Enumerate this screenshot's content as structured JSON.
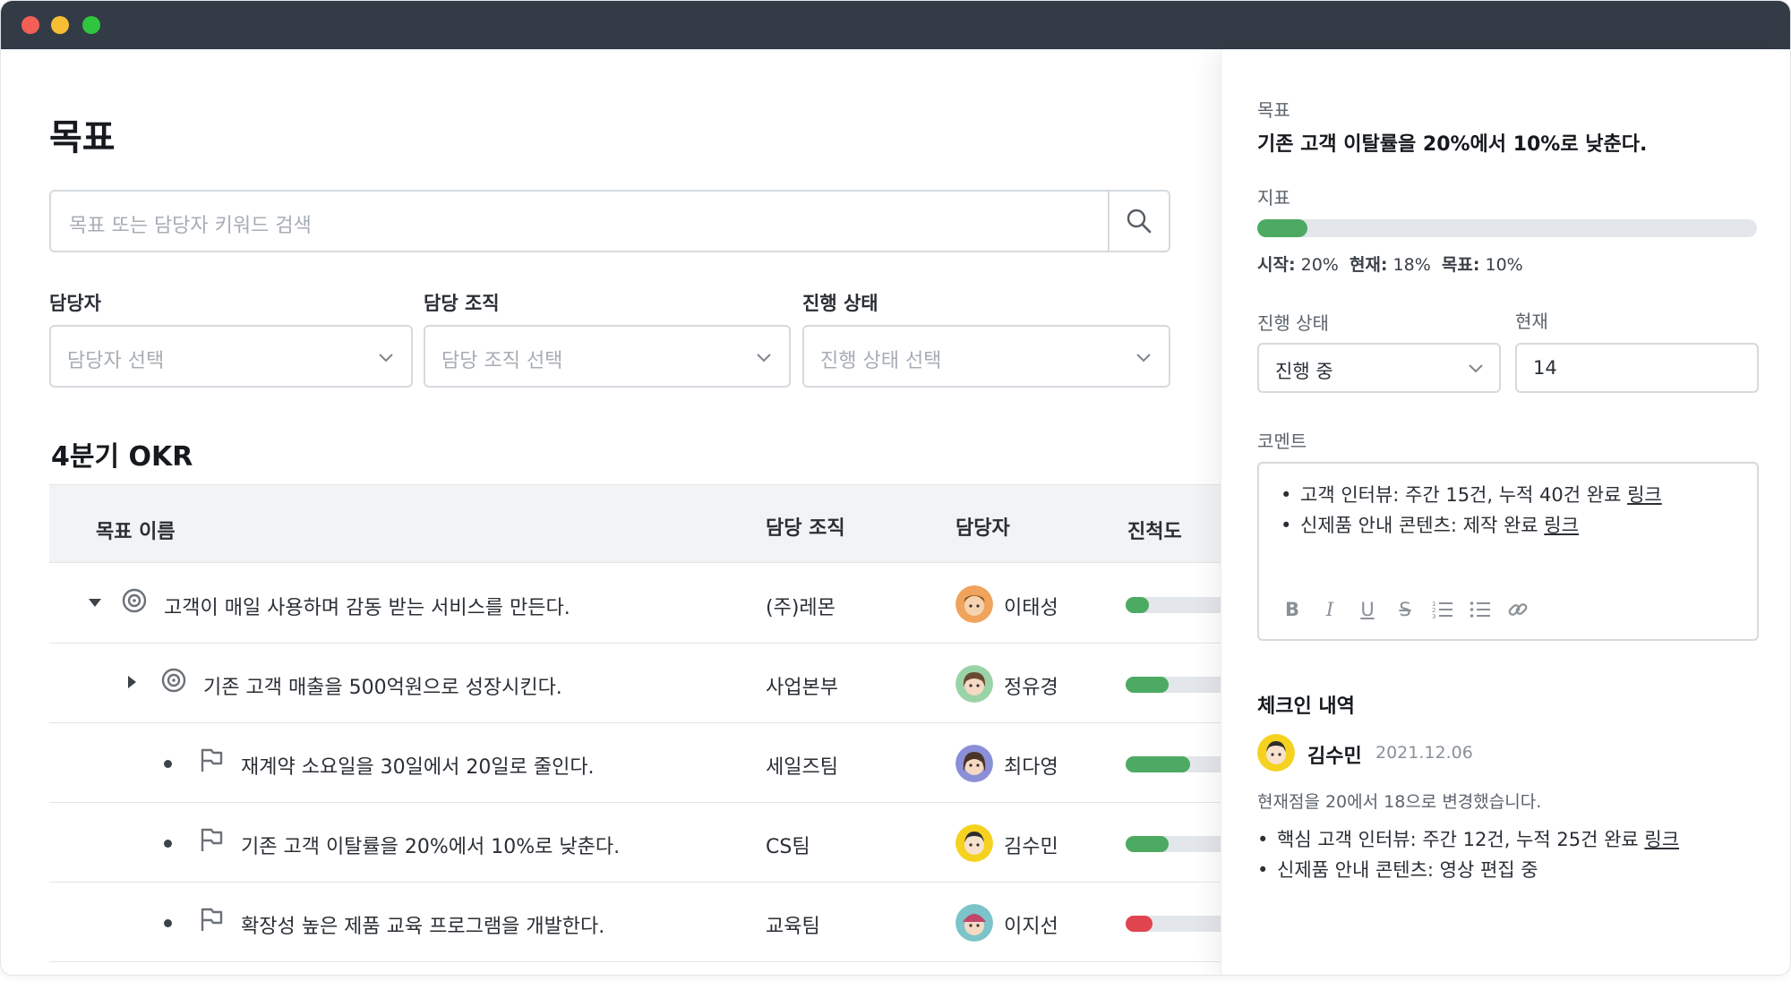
{
  "page": {
    "title": "목표",
    "search_placeholder": "목표 또는 담당자 키워드 검색"
  },
  "filters": [
    {
      "label": "담당자",
      "placeholder": "담당자 선택"
    },
    {
      "label": "담당 조직",
      "placeholder": "담당 조직 선택"
    },
    {
      "label": "진행 상태",
      "placeholder": "진행 상태 선택"
    }
  ],
  "section_title": "4분기 OKR",
  "table": {
    "headers": {
      "name": "목표 이름",
      "org": "담당 조직",
      "owner": "담당자",
      "progress": "진척도"
    },
    "rows": [
      {
        "name": "고객이 매일 사용하며 감동 받는 서비스를 만든다.",
        "org": "(주)레몬",
        "owner": "이태성",
        "progress": 0.22,
        "color": "#4caa63",
        "icon": "target-icon",
        "toggle": "expanded"
      },
      {
        "name": "기존 고객 매출을 500억원으로 성장시킨다.",
        "org": "사업본부",
        "owner": "정유경",
        "progress": 0.4,
        "color": "#4caa63",
        "icon": "target-icon",
        "toggle": "collapsed"
      },
      {
        "name": "재계약 소요일을 30일에서 20일로 줄인다.",
        "org": "세일즈팀",
        "owner": "최다영",
        "progress": 0.6,
        "color": "#4caa63",
        "icon": "flag-icon",
        "toggle": "none"
      },
      {
        "name": "기존 고객 이탈률을 20%에서 10%로 낮춘다.",
        "org": "CS팀",
        "owner": "김수민",
        "progress": 0.4,
        "color": "#4caa63",
        "icon": "flag-icon",
        "toggle": "none"
      },
      {
        "name": "확장성 높은 제품 교육 프로그램을 개발한다.",
        "org": "교육팀",
        "owner": "이지선",
        "progress": 0.25,
        "color": "#e0444f",
        "icon": "flag-icon",
        "toggle": "none"
      }
    ]
  },
  "panel": {
    "goal_label": "목표",
    "goal_text": "기존 고객 이탈률을 20%에서 10%로 낮춘다.",
    "metric_label": "지표",
    "metric_progress": 0.1,
    "metric_start_label": "시작:",
    "metric_start": "20%",
    "metric_current_label": "현재:",
    "metric_current": "18%",
    "metric_target_label": "목표:",
    "metric_target": "10%",
    "status_label": "진행 상태",
    "status_value": "진행 중",
    "current_label": "현재",
    "current_value": "14",
    "comment_label": "코멘트",
    "comment_items": [
      {
        "text": "고객 인터뷰: 주간 15건, 누적 40건 완료 ",
        "link": "링크"
      },
      {
        "text": "신제품 안내 콘텐츠: 제작 완료 ",
        "link": "링크"
      }
    ],
    "toolbar": {
      "bold": "B",
      "italic": "I",
      "underline": "U",
      "strike": "S"
    },
    "checkin_title": "체크인 내역",
    "checkin_name": "김수민",
    "checkin_date": "2021.12.06",
    "checkin_desc": "현재점을 20에서 18으로 변경했습니다.",
    "checkin_items": [
      {
        "text": "핵심 고객 인터뷰: 주간 12건, 누적 25건 완료 ",
        "link": "링크"
      },
      {
        "text": "신제품 안내 콘텐츠: 영상 편집 중",
        "link": ""
      }
    ]
  },
  "colors": {
    "green": "#4caa63",
    "red": "#e0444f",
    "titlebar": "#333b46"
  }
}
